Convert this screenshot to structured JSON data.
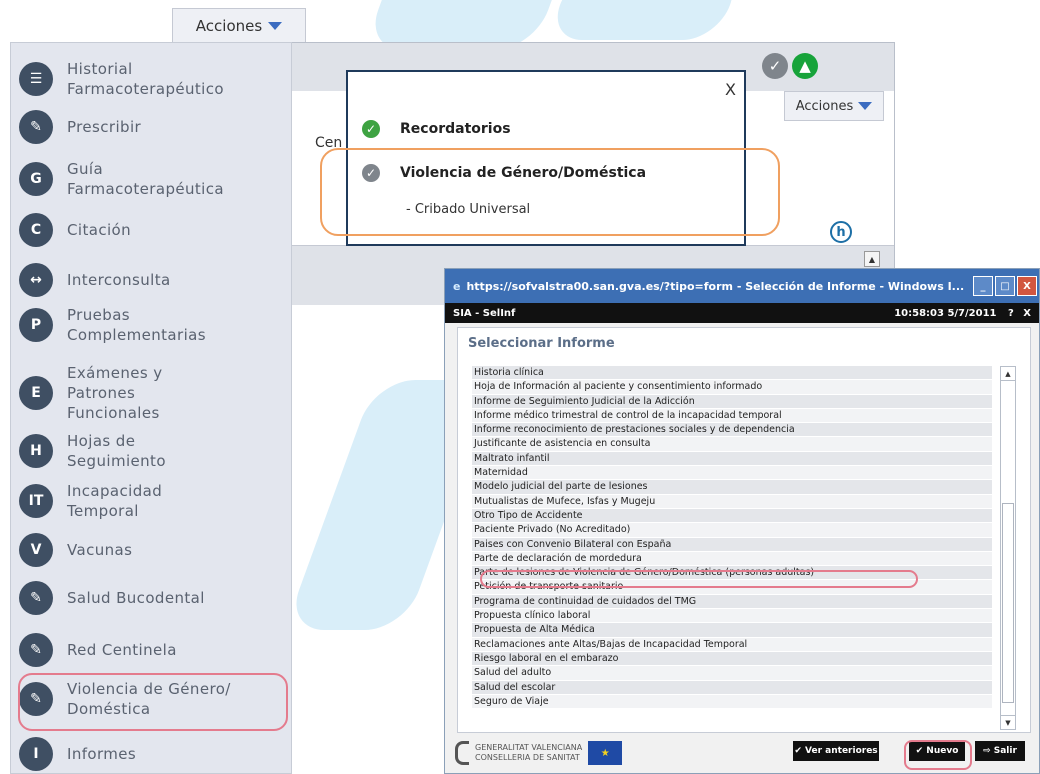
{
  "top_bar": {
    "acciones_label": "Acciones"
  },
  "sidebar": {
    "items": [
      {
        "icon": "history-icon",
        "glyph": "☰",
        "label_lines": [
          "Historial",
          "Farmacoterapéutico"
        ]
      },
      {
        "icon": "prescription-icon",
        "glyph": "✎",
        "label_lines": [
          "Prescribir"
        ]
      },
      {
        "icon": "guide-icon",
        "glyph": "G",
        "label_lines": [
          "Guía",
          "Farmacoterapéutica"
        ]
      },
      {
        "icon": "appointment-icon",
        "glyph": "C",
        "label_lines": [
          "Citación"
        ]
      },
      {
        "icon": "interconsultation-icon",
        "glyph": "↔",
        "label_lines": [
          "Interconsulta"
        ]
      },
      {
        "icon": "tests-icon",
        "glyph": "P",
        "label_lines": [
          "Pruebas",
          "Complementarias"
        ]
      },
      {
        "icon": "exams-icon",
        "glyph": "E",
        "label_lines": [
          "Exámenes y",
          "Patrones",
          "Funcionales"
        ]
      },
      {
        "icon": "followup-icon",
        "glyph": "H",
        "label_lines": [
          "Hojas de",
          "Seguimiento"
        ]
      },
      {
        "icon": "temporary-disability-icon",
        "glyph": "IT",
        "label_lines": [
          "Incapacidad",
          "Temporal"
        ]
      },
      {
        "icon": "vaccine-icon",
        "glyph": "V",
        "label_lines": [
          "Vacunas"
        ]
      },
      {
        "icon": "oral-health-icon",
        "glyph": "✎",
        "label_lines": [
          "Salud Bucodental"
        ]
      },
      {
        "icon": "sentinel-network-icon",
        "glyph": "✎",
        "label_lines": [
          "Red Centinela"
        ]
      },
      {
        "icon": "gender-violence-icon",
        "glyph": "✎",
        "label_lines": [
          "Violencia de Género/",
          "Doméstica"
        ]
      },
      {
        "icon": "reports-icon",
        "glyph": "I",
        "label_lines": [
          "Informes"
        ]
      }
    ]
  },
  "panel": {
    "acciones_label": "Acciones",
    "cen_label": "Cen",
    "help_glyph": "h"
  },
  "popup": {
    "close": "X",
    "recordatorios": "Recordatorios",
    "violencia": "Violencia de Género/Doméstica",
    "cribado": "- Cribado Universal",
    "colors": {
      "green": "#3ea342",
      "grey": "#7f858c"
    }
  },
  "window": {
    "title": "https://sofvalstra00.san.gva.es/?tipo=form - Selección de Informe - Windows I...",
    "system": "SIA - SelInf",
    "timestamp": "10:58:03 5/7/2011",
    "help": "?",
    "close_x": "X",
    "heading": "Seleccionar Informe",
    "list_items": [
      "Historia clínica",
      "Hoja de Información al paciente y consentimiento informado",
      "Informe de Seguimiento Judicial de la Adicción",
      "Informe médico trimestral de control de la incapacidad temporal",
      "Informe reconocimiento de prestaciones sociales y de dependencia",
      "Justificante de asistencia en consulta",
      "Maltrato infantil",
      "Maternidad",
      "Modelo judicial del parte de lesiones",
      "Mutualistas de Mufece, Isfas y Mugeju",
      "Otro Tipo de Accidente",
      "Paciente Privado (No Acreditado)",
      "Paises con Convenio Bilateral con España",
      "Parte de declaración de mordedura",
      "Parte de lesiones de Violencia de Género/Doméstica (personas adultas)",
      "Petición de transporte sanitario",
      "Programa de continuidad de cuidados del TMG",
      "Propuesta clínico laboral",
      "Propuesta de Alta Médica",
      "Reclamaciones ante Altas/Bajas de Incapacidad Temporal",
      "Riesgo laboral en el embarazo",
      "Salud del adulto",
      "Salud del escolar",
      "Seguro de Viaje"
    ],
    "logo_text": [
      "GENERALITAT VALENCIANA",
      "CONSELLERIA DE SANITAT"
    ],
    "buttons": {
      "ver_anteriores": "✔ Ver anteriores",
      "nuevo": "✔ Nuevo",
      "salir": "⇨ Salir"
    }
  }
}
